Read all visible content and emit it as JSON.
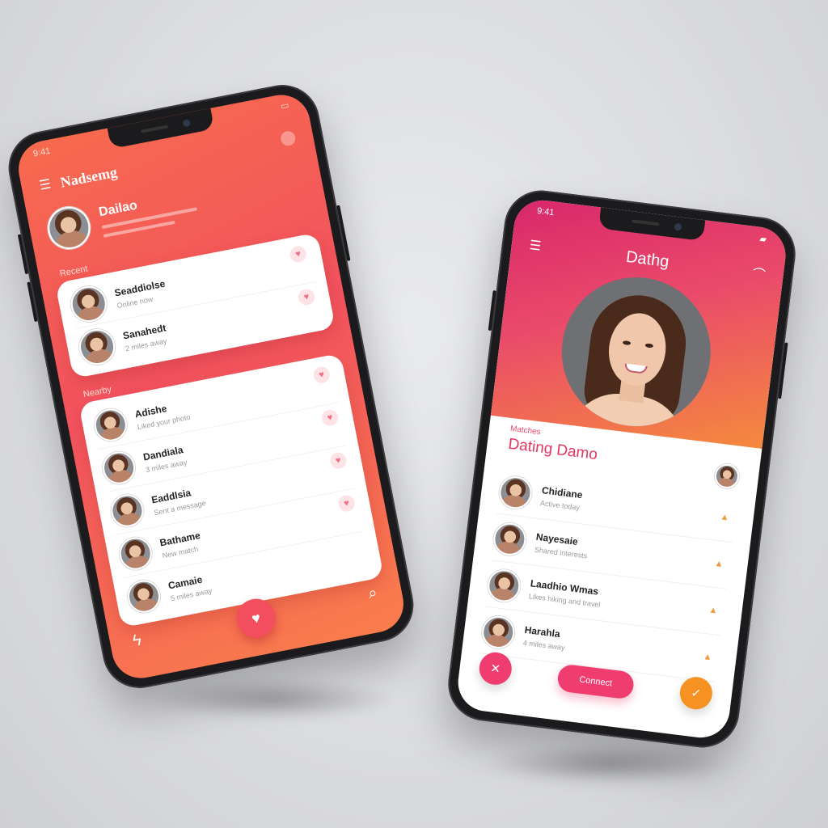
{
  "phone1": {
    "status": {
      "time": "9:41"
    },
    "title": "Nadsemg",
    "profile": {
      "name": "Dailao"
    },
    "section1_label": "Recent",
    "section2_label": "Nearby",
    "matches": [
      {
        "name": "Seaddiolse",
        "subtitle": "Online now"
      },
      {
        "name": "Sanahedt",
        "subtitle": "2 miles away"
      }
    ],
    "list": [
      {
        "name": "Adishe",
        "subtitle": "Liked your photo"
      },
      {
        "name": "Dandiala",
        "subtitle": "3 miles away"
      },
      {
        "name": "Eaddlsia",
        "subtitle": "Sent a message"
      },
      {
        "name": "Bathame",
        "subtitle": "New match"
      },
      {
        "name": "Camaie",
        "subtitle": "5 miles away"
      }
    ]
  },
  "phone2": {
    "status": {
      "time": "9:41"
    },
    "title": "Dathg",
    "small_label": "Matches",
    "section_title": "Dating Damo",
    "list": [
      {
        "name": "Chidiane",
        "subtitle": "Active today"
      },
      {
        "name": "Nayesaie",
        "subtitle": "Shared interests"
      },
      {
        "name": "Laadhio Wmas",
        "subtitle": "Likes hiking and travel"
      },
      {
        "name": "Harahla",
        "subtitle": "4 miles away"
      }
    ],
    "pill_button": "Connect"
  },
  "colors": {
    "phone1_gradient_top": "#f76a4e",
    "phone1_gradient_bottom": "#fa7d4c",
    "phone2_gradient_start": "#d8276b",
    "phone2_gradient_end": "#f58a3d",
    "accent_pink": "#ee3d6e",
    "accent_orange": "#f59222"
  }
}
